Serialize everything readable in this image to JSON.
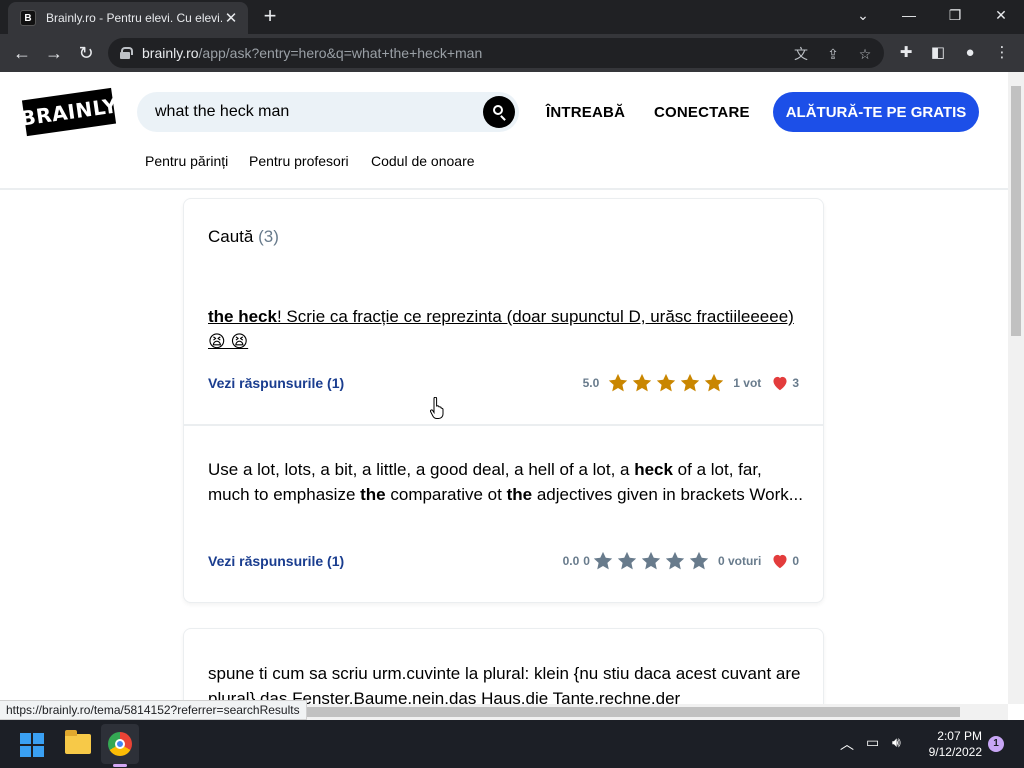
{
  "browser": {
    "tab_title": "Brainly.ro - Pentru elevi. Cu elevi.",
    "favicon_letter": "B",
    "url_host": "brainly.ro",
    "url_path": "/app/ask?entry=hero&q=what+the+heck+man",
    "status_url": "https://brainly.ro/tema/5814152?referrer=searchResults"
  },
  "header": {
    "logo": "BRAINLY",
    "search_value": "what the heck man",
    "ask_label": "ÎNTREABĂ",
    "login_label": "CONECTARE",
    "join_label": "ALĂTURĂ-TE PE GRATIS",
    "subnav": [
      "Pentru părinți",
      "Pentru profesori",
      "Codul de onoare"
    ]
  },
  "results": {
    "title": "Caută",
    "count": "(3)",
    "items": [
      {
        "bold": "the heck",
        "text": "! Scrie ca fracție ce reprezinta (doar supunctul D, urăsc fractiileeeee) 😫 😫 ",
        "answers_label": "Vezi răspunsurile (1)",
        "rating": "5.0",
        "votes": "1 vot",
        "likes": "3"
      },
      {
        "parts": [
          "Use a lot, lots, a bit, a little, a good deal, a hell of a lot, a ",
          "heck",
          " of a lot, far, much to emphasize ",
          "the",
          " comparative ot ",
          "the",
          " adjectives given in brackets Work..."
        ],
        "answers_label": "Vezi răspunsurile (1)",
        "rating": "0.0",
        "rating_count": "0",
        "votes": "0 voturi",
        "likes": "0"
      },
      {
        "text": "spune ti cum sa scriu urm.cuvinte la plural: klein {nu stiu daca acest cuvant are plural} das Fenster.Baume.nein.das Haus.die Tante.rechne.der"
      }
    ]
  },
  "taskbar": {
    "time": "2:07 PM",
    "date": "9/12/2022",
    "notifications": "1"
  },
  "colors": {
    "brand_blue": "#1c4fe8",
    "star_gold": "#c98600",
    "star_gray": "#687b8c",
    "heart_red": "#e33c3c",
    "link_blue": "#1a3d8f"
  }
}
